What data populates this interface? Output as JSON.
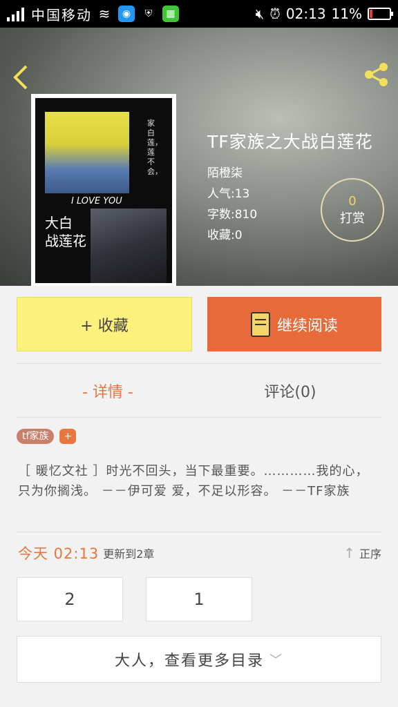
{
  "status_bar": {
    "carrier": "中国移动",
    "time": "02:13",
    "battery": "11%"
  },
  "cover": {
    "title_line1": "大白",
    "title_line2": "战莲花",
    "tagline": "I LOVE YOU",
    "vertical_text": "家白莲，莲不会，"
  },
  "book": {
    "title": "TF家族之大战白莲花",
    "author": "陌橙柒",
    "popularity": "人气:13",
    "word_count": "字数:810",
    "favorites": "收藏:0"
  },
  "tip": {
    "count": "0",
    "label": "打赏"
  },
  "actions": {
    "collect_label": "+ 收藏",
    "read_label": "继续阅读"
  },
  "tabs": [
    {
      "label": "- 详情 -",
      "active": true
    },
    {
      "label": "评论(0)",
      "active": false
    }
  ],
  "tags": [
    "tf家族",
    "+"
  ],
  "description": "［ 暖忆文社 ］时光不回头，当下最重要。…………我的心，只为你搁浅。 －－伊可爱 爱，不足以形容。 －－TF家族",
  "update": {
    "time": "今天 02:13",
    "text": "更新到2章",
    "sort_label": "正序"
  },
  "chapters": [
    "2",
    "1"
  ],
  "more_catalog": "大人，查看更多目录",
  "colors": {
    "accent_orange": "#e66a3a",
    "collect_yellow": "#fbf17c",
    "back_icon": "#f4df5a"
  }
}
